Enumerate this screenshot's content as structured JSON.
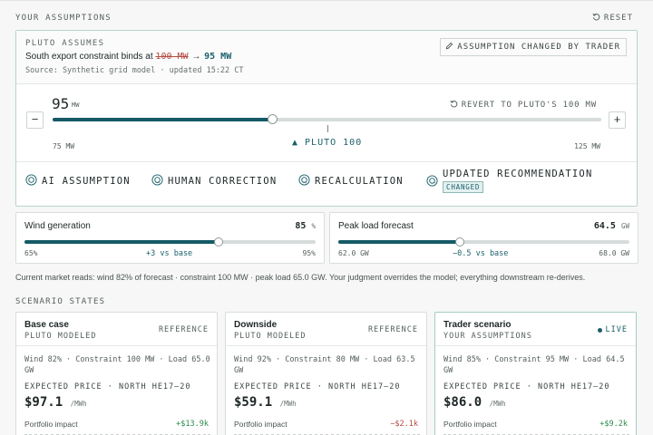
{
  "header": {
    "title": "YOUR ASSUMPTIONS",
    "reset_label": "RESET"
  },
  "main": {
    "pluto_assumes": "PLUTO ASSUMES",
    "constraint_prefix": "South export constraint binds at",
    "old_value": "100 MW",
    "arrow": "→",
    "new_value": "95 MW",
    "source": "Source: Synthetic grid model · updated 15:22 CT",
    "changed_badge": "ASSUMPTION CHANGED BY TRADER",
    "slider": {
      "value": "95",
      "unit": "MW",
      "revert_label": "REVERT TO PLUTO'S 100 MW",
      "min_label": "75 MW",
      "max_label": "125 MW",
      "min": 75,
      "max": 125,
      "current": 95,
      "pluto": 100,
      "pluto_marker": "▲ PLUTO 100",
      "minus": "−",
      "plus": "+"
    },
    "flow": [
      {
        "label": "AI ASSUMPTION"
      },
      {
        "label": "HUMAN CORRECTION"
      },
      {
        "label": "RECALCULATION"
      },
      {
        "label": "UPDATED RECOMMENDATION",
        "tag": "CHANGED"
      }
    ],
    "flow_arrow": "→"
  },
  "mini": [
    {
      "title": "Wind generation",
      "value": "85",
      "unit": "%",
      "min_label": "65%",
      "max_label": "95%",
      "delta": "+3 vs base",
      "min": 65,
      "max": 95,
      "current": 85
    },
    {
      "title": "Peak load forecast",
      "value": "64.5",
      "unit": "GW",
      "min_label": "62.0 GW",
      "max_label": "68.0 GW",
      "delta": "−0.5 vs base",
      "min": 62,
      "max": 68,
      "current": 64.5
    }
  ],
  "market_note": "Current market reads: wind 82% of forecast · constraint 100 MW · peak load 65.0 GW. Your judgment overrides the model; everything downstream re-derives.",
  "scenarios_title": "SCENARIO STATES",
  "scenarios": [
    {
      "name": "Base case",
      "sub": "PLUTO MODELED",
      "tag": "REFERENCE",
      "assumptions": "Wind 82% · Constraint 100 MW · Load 65.0 GW",
      "price_label": "EXPECTED PRICE · NORTH HE17–20",
      "price": "$97.1",
      "price_unit": "/MWh",
      "impact_label": "Portfolio impact",
      "impact": "+$13.9k",
      "impact_sign": "pos"
    },
    {
      "name": "Downside",
      "sub": "PLUTO MODELED",
      "tag": "REFERENCE",
      "assumptions": "Wind 92% · Constraint 80 MW · Load 63.5 GW",
      "price_label": "EXPECTED PRICE · NORTH HE17–20",
      "price": "$59.1",
      "price_unit": "/MWh",
      "impact_label": "Portfolio impact",
      "impact": "−$2.1k",
      "impact_sign": "neg"
    },
    {
      "name": "Trader scenario",
      "sub": "YOUR ASSUMPTIONS",
      "tag": "LIVE",
      "assumptions": "Wind 85% · Constraint 95 MW · Load 64.5 GW",
      "price_label": "EXPECTED PRICE · NORTH HE17–20",
      "price": "$86.0",
      "price_unit": "/MWh",
      "impact_label": "Portfolio impact",
      "impact": "+$9.2k",
      "impact_sign": "pos"
    }
  ]
}
